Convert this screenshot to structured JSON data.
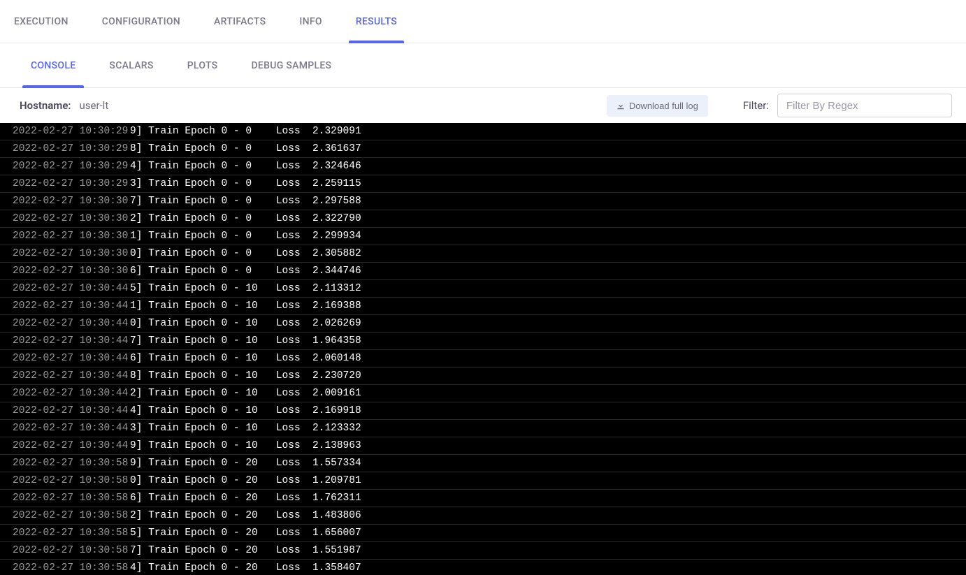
{
  "tabs_primary": [
    {
      "id": "execution",
      "label": "EXECUTION"
    },
    {
      "id": "configuration",
      "label": "CONFIGURATION"
    },
    {
      "id": "artifacts",
      "label": "ARTIFACTS"
    },
    {
      "id": "info",
      "label": "INFO"
    },
    {
      "id": "results",
      "label": "RESULTS"
    }
  ],
  "active_primary": "results",
  "tabs_secondary": [
    {
      "id": "console",
      "label": "CONSOLE"
    },
    {
      "id": "scalars",
      "label": "SCALARS"
    },
    {
      "id": "plots",
      "label": "PLOTS"
    },
    {
      "id": "debug",
      "label": "DEBUG SAMPLES"
    }
  ],
  "active_secondary": "console",
  "hostname_label": "Hostname:",
  "hostname_value": "user-lt",
  "download_label": "Download full log",
  "filter_label": "Filter:",
  "filter_placeholder": "Filter By Regex",
  "logs": [
    {
      "ts": "2022-02-27 10:30:29",
      "worker": "9",
      "epoch": "0",
      "step": "0",
      "loss": "2.329091"
    },
    {
      "ts": "2022-02-27 10:30:29",
      "worker": "8",
      "epoch": "0",
      "step": "0",
      "loss": "2.361637"
    },
    {
      "ts": "2022-02-27 10:30:29",
      "worker": "4",
      "epoch": "0",
      "step": "0",
      "loss": "2.324646"
    },
    {
      "ts": "2022-02-27 10:30:29",
      "worker": "3",
      "epoch": "0",
      "step": "0",
      "loss": "2.259115"
    },
    {
      "ts": "2022-02-27 10:30:30",
      "worker": "7",
      "epoch": "0",
      "step": "0",
      "loss": "2.297588"
    },
    {
      "ts": "2022-02-27 10:30:30",
      "worker": "2",
      "epoch": "0",
      "step": "0",
      "loss": "2.322790"
    },
    {
      "ts": "2022-02-27 10:30:30",
      "worker": "1",
      "epoch": "0",
      "step": "0",
      "loss": "2.299934"
    },
    {
      "ts": "2022-02-27 10:30:30",
      "worker": "0",
      "epoch": "0",
      "step": "0",
      "loss": "2.305882"
    },
    {
      "ts": "2022-02-27 10:30:30",
      "worker": "6",
      "epoch": "0",
      "step": "0",
      "loss": "2.344746"
    },
    {
      "ts": "2022-02-27 10:30:44",
      "worker": "5",
      "epoch": "0",
      "step": "10",
      "loss": "2.113312"
    },
    {
      "ts": "2022-02-27 10:30:44",
      "worker": "1",
      "epoch": "0",
      "step": "10",
      "loss": "2.169388"
    },
    {
      "ts": "2022-02-27 10:30:44",
      "worker": "0",
      "epoch": "0",
      "step": "10",
      "loss": "2.026269"
    },
    {
      "ts": "2022-02-27 10:30:44",
      "worker": "7",
      "epoch": "0",
      "step": "10",
      "loss": "1.964358"
    },
    {
      "ts": "2022-02-27 10:30:44",
      "worker": "6",
      "epoch": "0",
      "step": "10",
      "loss": "2.060148"
    },
    {
      "ts": "2022-02-27 10:30:44",
      "worker": "8",
      "epoch": "0",
      "step": "10",
      "loss": "2.230720"
    },
    {
      "ts": "2022-02-27 10:30:44",
      "worker": "2",
      "epoch": "0",
      "step": "10",
      "loss": "2.009161"
    },
    {
      "ts": "2022-02-27 10:30:44",
      "worker": "4",
      "epoch": "0",
      "step": "10",
      "loss": "2.169918"
    },
    {
      "ts": "2022-02-27 10:30:44",
      "worker": "3",
      "epoch": "0",
      "step": "10",
      "loss": "2.123332"
    },
    {
      "ts": "2022-02-27 10:30:44",
      "worker": "9",
      "epoch": "0",
      "step": "10",
      "loss": "2.138963"
    },
    {
      "ts": "2022-02-27 10:30:58",
      "worker": "9",
      "epoch": "0",
      "step": "20",
      "loss": "1.557334"
    },
    {
      "ts": "2022-02-27 10:30:58",
      "worker": "0",
      "epoch": "0",
      "step": "20",
      "loss": "1.209781"
    },
    {
      "ts": "2022-02-27 10:30:58",
      "worker": "6",
      "epoch": "0",
      "step": "20",
      "loss": "1.762311"
    },
    {
      "ts": "2022-02-27 10:30:58",
      "worker": "2",
      "epoch": "0",
      "step": "20",
      "loss": "1.483806"
    },
    {
      "ts": "2022-02-27 10:30:58",
      "worker": "5",
      "epoch": "0",
      "step": "20",
      "loss": "1.656007"
    },
    {
      "ts": "2022-02-27 10:30:58",
      "worker": "7",
      "epoch": "0",
      "step": "20",
      "loss": "1.551987"
    },
    {
      "ts": "2022-02-27 10:30:58",
      "worker": "4",
      "epoch": "0",
      "step": "20",
      "loss": "1.358407"
    }
  ]
}
